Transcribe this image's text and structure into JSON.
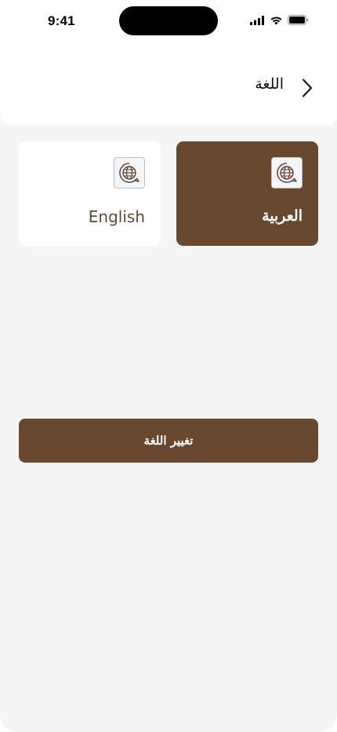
{
  "status_bar": {
    "time": "9:41",
    "icons": [
      "signal-icon",
      "wifi-icon",
      "battery-icon"
    ]
  },
  "header": {
    "title": "اللغة",
    "back_icon": "chevron-right-icon"
  },
  "languages": [
    {
      "label": "English",
      "icon": "globe-chat-icon",
      "selected": false
    },
    {
      "label": "العربية",
      "icon": "globe-chat-icon",
      "selected": true
    }
  ],
  "actions": {
    "change_language_label": "تغيير اللغة"
  },
  "colors": {
    "accent": "#68492f",
    "background": "#f5f5f5",
    "card": "#ffffff"
  }
}
